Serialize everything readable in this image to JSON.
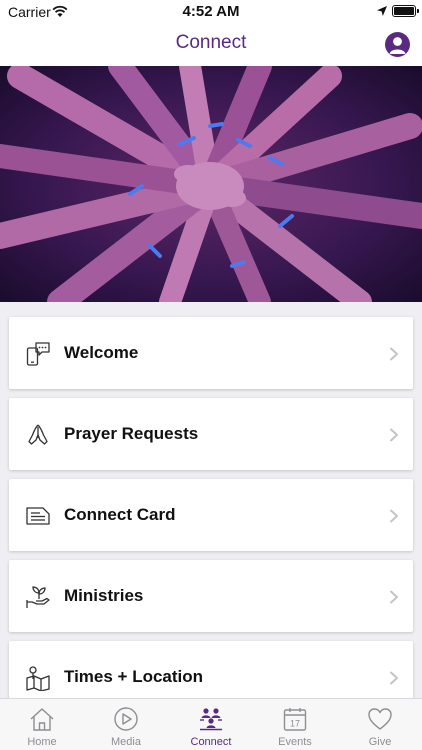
{
  "status_bar": {
    "carrier": "Carrier",
    "time": "4:52 AM"
  },
  "nav": {
    "title": "Connect"
  },
  "menu": {
    "items": [
      {
        "label": "Welcome",
        "icon": "phone-chat-icon"
      },
      {
        "label": "Prayer Requests",
        "icon": "praying-hands-icon"
      },
      {
        "label": "Connect Card",
        "icon": "card-icon"
      },
      {
        "label": "Ministries",
        "icon": "plant-hand-icon"
      },
      {
        "label": "Times + Location",
        "icon": "map-pin-icon"
      }
    ]
  },
  "tab_bar": {
    "tabs": [
      {
        "label": "Home",
        "icon": "home-icon",
        "active": false
      },
      {
        "label": "Media",
        "icon": "play-icon",
        "active": false
      },
      {
        "label": "Connect",
        "icon": "people-icon",
        "active": true
      },
      {
        "label": "Events",
        "icon": "calendar-icon",
        "active": false,
        "badge": "17"
      },
      {
        "label": "Give",
        "icon": "heart-icon",
        "active": false
      }
    ]
  },
  "colors": {
    "accent": "#5a2a82",
    "inactive": "#8e8e93",
    "background": "#efeef2"
  }
}
